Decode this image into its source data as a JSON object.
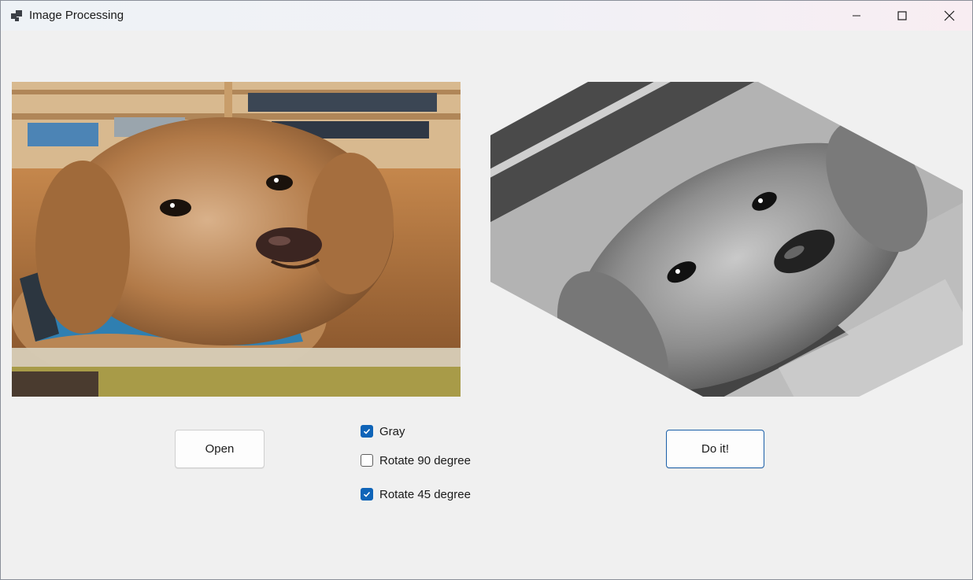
{
  "window": {
    "title": "Image Processing"
  },
  "titlebar": {
    "icons": {
      "app": "app-icon",
      "minimize": "minimize-icon",
      "maximize": "maximize-icon",
      "close": "close-icon"
    }
  },
  "images": {
    "original": {
      "description_icon": "dog-photo-color"
    },
    "processed": {
      "description_icon": "dog-photo-gray-rotated"
    }
  },
  "buttons": {
    "open_label": "Open",
    "doit_label": "Do it!"
  },
  "options": [
    {
      "label": "Gray",
      "checked": true
    },
    {
      "label": "Rotate 90 degree",
      "checked": false
    },
    {
      "label": "Rotate 45 degree",
      "checked": true
    }
  ],
  "colors": {
    "checkbox_accent": "#0f64b8",
    "primary_button_border": "#1a5fa8"
  }
}
